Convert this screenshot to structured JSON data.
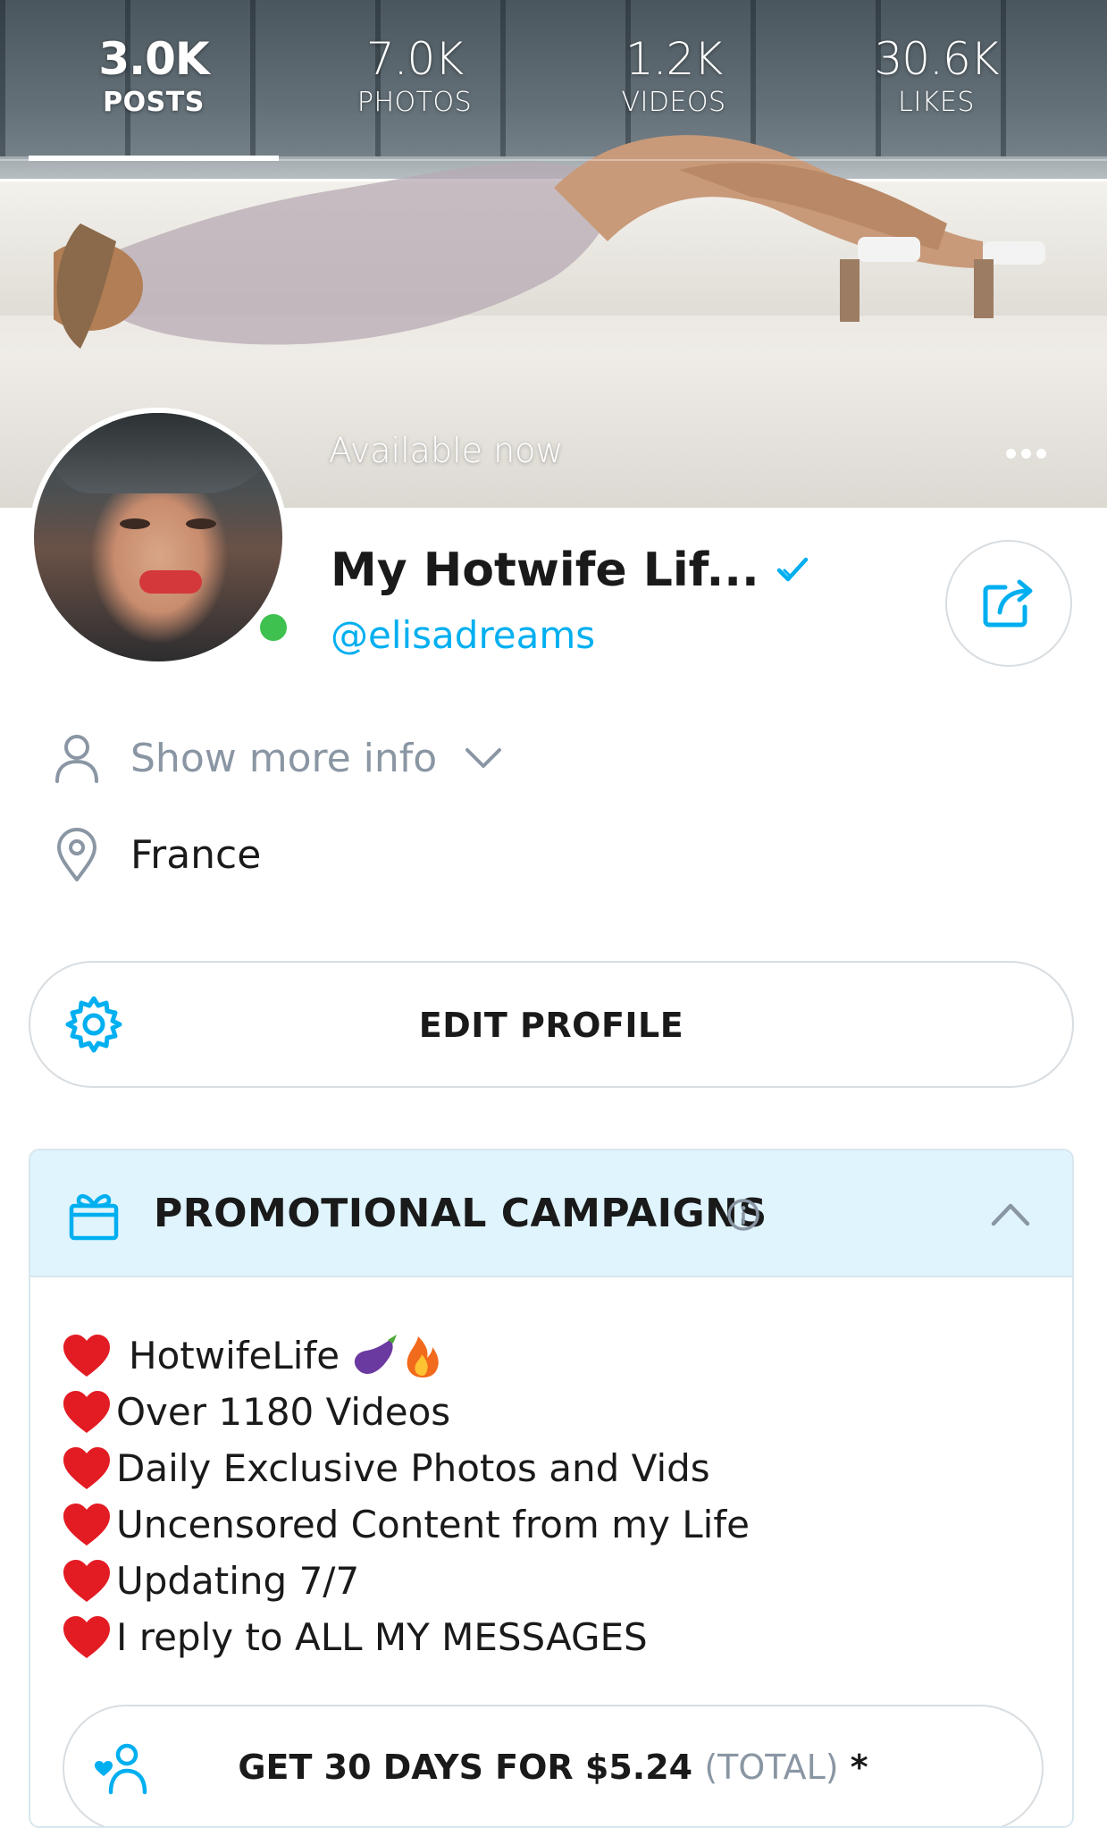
{
  "stats": [
    {
      "value": "3.0K",
      "label": "POSTS"
    },
    {
      "value": "7.0K",
      "label": "PHOTOS"
    },
    {
      "value": "1.2K",
      "label": "VIDEOS"
    },
    {
      "value": "30.6K",
      "label": "LIKES"
    }
  ],
  "cover": {
    "status": "Available now"
  },
  "profile": {
    "name": "My Hotwife Lif...",
    "handle": "@elisadreams",
    "online": true
  },
  "info": {
    "more_label": "Show more info",
    "location": "France"
  },
  "edit_profile_label": "EDIT PROFILE",
  "promo": {
    "title": "PROMOTIONAL CAMPAIGNS",
    "bio_lines": [
      "HotwifeLife",
      "Over 1180 Videos",
      "Daily Exclusive Photos and Vids",
      "Uncensored Content from my Life",
      "Updating 7/7",
      "I reply to ALL MY MESSAGES"
    ],
    "subscribe": {
      "main": "GET 30 DAYS FOR $5.24",
      "suffix": "(TOTAL)",
      "asterisk": "*"
    }
  },
  "colors": {
    "accent": "#00aff0",
    "muted_text": "#8a96a3",
    "online": "#3fc14f",
    "promo_header_bg": "#dff4fd"
  },
  "icons": [
    "ellipsis-icon",
    "verified-icon",
    "share-icon",
    "user-icon",
    "chevron-down-icon",
    "location-pin-icon",
    "gear-icon",
    "gift-icon",
    "info-icon",
    "chevron-up-icon",
    "heart-icon",
    "eggplant-icon",
    "fire-icon",
    "subscribe-user-icon"
  ]
}
